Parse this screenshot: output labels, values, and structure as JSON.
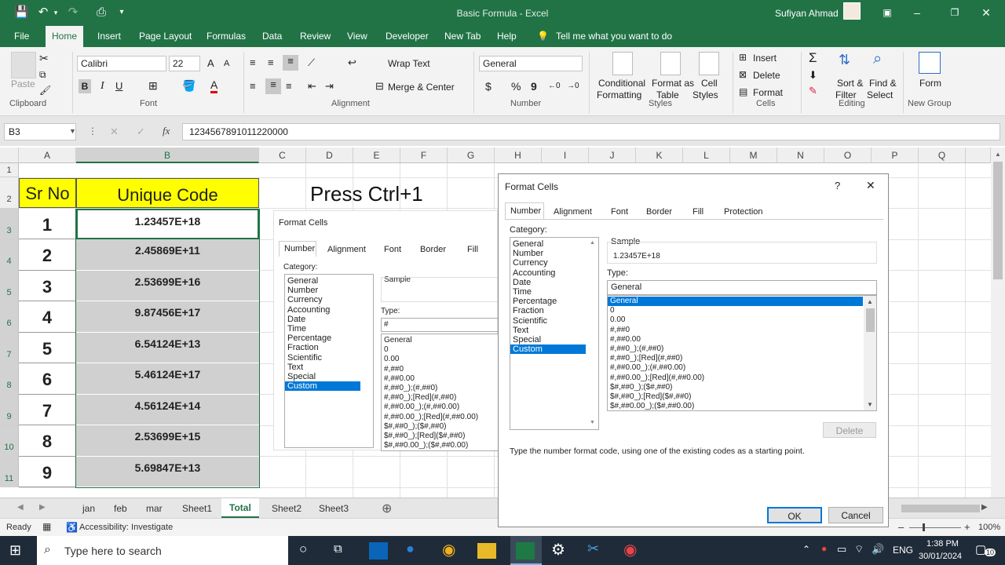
{
  "title_bar": {
    "title": "Basic Formula  -  Excel",
    "user": "Sufiyan Ahmad"
  },
  "ribbon_tabs": [
    "File",
    "Home",
    "Insert",
    "Page Layout",
    "Formulas",
    "Data",
    "Review",
    "View",
    "Developer",
    "New Tab",
    "Help",
    "Tell me what you want to do"
  ],
  "ribbon": {
    "paste": "Paste",
    "font_name": "Calibri",
    "font_size": "22",
    "wrap_text": "Wrap Text",
    "merge_center": "Merge & Center",
    "number_format": "General",
    "cond_format": "Conditional",
    "cond_format2": "Formatting",
    "format_table": "Format as",
    "format_table2": "Table",
    "cell_styles": "Cell",
    "cell_styles2": "Styles",
    "insert": "Insert",
    "delete": "Delete",
    "format": "Format",
    "sort_filter": "Sort &",
    "sort_filter2": "Filter",
    "find_select": "Find &",
    "find_select2": "Select",
    "form": "Form",
    "groups": [
      "Clipboard",
      "Font",
      "Alignment",
      "Number",
      "Styles",
      "Cells",
      "Editing",
      "New Group"
    ]
  },
  "formula_bar": {
    "name_box": "B3",
    "formula": "1234567891011220000"
  },
  "columns": [
    "A",
    "B",
    "C",
    "D",
    "E",
    "F",
    "G",
    "H",
    "I",
    "J",
    "K",
    "L",
    "M",
    "N",
    "O",
    "P",
    "Q"
  ],
  "rows": [
    "1",
    "2",
    "3",
    "4",
    "5",
    "6",
    "7",
    "8",
    "9",
    "10",
    "11"
  ],
  "table": {
    "header_sr": "Sr No",
    "header_code": "Unique Code",
    "sr": [
      "1",
      "2",
      "3",
      "4",
      "5",
      "6",
      "7",
      "8",
      "9"
    ],
    "codes": [
      "1.23457E+18",
      "2.45869E+11",
      "2.53699E+16",
      "9.87456E+17",
      "6.54124E+13",
      "5.46124E+17",
      "4.56124E+14",
      "2.53699E+15",
      "5.69847E+13"
    ]
  },
  "note": "Press Ctrl+1",
  "bg_dialog": {
    "title": "Format Cells",
    "tabs": [
      "Number",
      "Alignment",
      "Font",
      "Border",
      "Fill"
    ],
    "category_label": "Category:",
    "categories": [
      "General",
      "Number",
      "Currency",
      "Accounting",
      "Date",
      "Time",
      "Percentage",
      "Fraction",
      "Scientific",
      "Text",
      "Special",
      "Custom"
    ],
    "sample_label": "Sample",
    "type_label": "Type:",
    "type_value": "#",
    "types": [
      "General",
      "0",
      "0.00",
      "#,##0",
      "#,##0.00",
      "#,##0_);(#,##0)",
      "#,##0_);[Red](#,##0)",
      "#,##0.00_);(#,##0.00)",
      "#,##0.00_);[Red](#,##0.00)",
      "$#,##0_);($#,##0)",
      "$#,##0_);[Red]($#,##0)",
      "$#,##0.00_);($#,##0.00)"
    ]
  },
  "dialog": {
    "title": "Format Cells",
    "help": "?",
    "close": "✕",
    "tabs": [
      "Number",
      "Alignment",
      "Font",
      "Border",
      "Fill",
      "Protection"
    ],
    "category_label": "Category:",
    "categories": [
      "General",
      "Number",
      "Currency",
      "Accounting",
      "Date",
      "Time",
      "Percentage",
      "Fraction",
      "Scientific",
      "Text",
      "Special",
      "Custom"
    ],
    "sample_label": "Sample",
    "sample_value": "1.23457E+18",
    "type_label": "Type:",
    "type_value": "General",
    "types": [
      "General",
      "0",
      "0.00",
      "#,##0",
      "#,##0.00",
      "#,##0_);(#,##0)",
      "#,##0_);[Red](#,##0)",
      "#,##0.00_);(#,##0.00)",
      "#,##0.00_);[Red](#,##0.00)",
      "$#,##0_);($#,##0)",
      "$#,##0_);[Red]($#,##0)",
      "$#,##0.00_);($#,##0.00)"
    ],
    "delete_btn": "Delete",
    "hint": "Type the number format code, using one of the existing codes as a starting point.",
    "ok": "OK",
    "cancel": "Cancel"
  },
  "sheet_tabs": [
    "jan",
    "feb",
    "mar",
    "Sheet1",
    "Total",
    "Sheet2",
    "Sheet3"
  ],
  "status": {
    "ready": "Ready",
    "accessibility": "Accessibility: Investigate",
    "zoom": "100%"
  },
  "taskbar": {
    "search": "Type here to search",
    "lang": "ENG",
    "time": "1:38 PM",
    "date": "30/01/2024",
    "notif": "10"
  },
  "colors": {
    "excel_green": "#217346",
    "header_yellow": "#ffff00",
    "selection_blue": "#0078d7"
  }
}
